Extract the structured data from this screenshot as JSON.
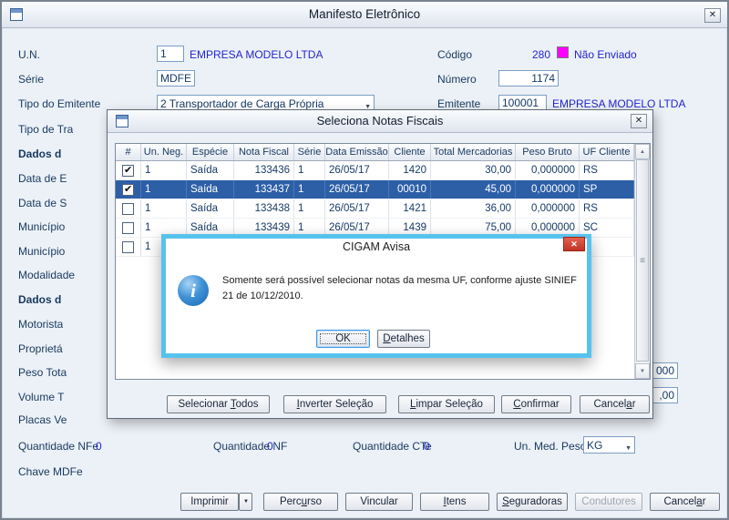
{
  "colors": {
    "status_swatch": "#FF00FF",
    "selected_row": "#2D5FA7",
    "avisa_border": "#57C3ED",
    "value_blue": "#2424CE"
  },
  "main_window": {
    "title": "Manifesto Eletrônico",
    "fields": {
      "un_label": "U.N.",
      "un_value": "1",
      "un_company": "EMPRESA MODELO LTDA",
      "codigo_label": "Código",
      "codigo_value": "280",
      "status_text": "Não Enviado",
      "serie_label": "Série",
      "serie_value": "MDFE",
      "numero_label": "Número",
      "numero_value": "1174",
      "tipo_emitente_label": "Tipo do Emitente",
      "tipo_emitente_value": "2 Transportador de Carga Própria",
      "emitente_label": "Emitente",
      "emitente_value": "100001",
      "emitente_company": "EMPRESA MODELO LTDA"
    },
    "left_labels": [
      "Tipo de Tra",
      "Dados d",
      "Data de E",
      "Data de S",
      "Município",
      "Município",
      "Modalidade",
      "Dados d",
      "Motorista",
      "Proprietá",
      "Peso Tota",
      "Volume T",
      "Placas Ve"
    ],
    "partial_fields": {
      "peso_tail": "000",
      "volume_tail": ",00"
    },
    "totals": {
      "qtde_nfe_label": "Quantidade NFe",
      "qtde_nfe_value": "0",
      "qtde_nf_label": "Quantidade NF",
      "qtde_nf_value": "0",
      "qtde_cte_label": "Quantidade CTe",
      "qtde_cte_value": "0",
      "un_med_peso_label": "Un. Med. Peso",
      "un_med_peso_value": "KG"
    },
    "chave_label": "Chave MDFe",
    "buttons": {
      "imprimir": "Imprimir",
      "percurso": "Perc&urso",
      "vincular": "Vincular",
      "itens": "&Itens",
      "seguradoras": "&Seguradoras",
      "condutores": "Condutores",
      "cancelar": "Cancel&ar"
    }
  },
  "notas_window": {
    "title": "Seleciona Notas Fiscais",
    "table": {
      "headers": [
        "#",
        "Un. Neg.",
        "Espécie",
        "Nota Fiscal",
        "Série",
        "Data Emissão",
        "Cliente",
        "Total Mercadorias",
        "Peso Bruto",
        "UF Cliente"
      ],
      "rows": [
        {
          "checked": true,
          "selected": false,
          "cells": [
            "1",
            "Saída",
            "133436",
            "1",
            "26/05/17",
            "1420",
            "30,00",
            "0,000000",
            "RS"
          ]
        },
        {
          "checked": true,
          "selected": true,
          "cells": [
            "1",
            "Saída",
            "133437",
            "1",
            "26/05/17",
            "00010",
            "45,00",
            "0,000000",
            "SP"
          ]
        },
        {
          "checked": false,
          "selected": false,
          "cells": [
            "1",
            "Saída",
            "133438",
            "1",
            "26/05/17",
            "1421",
            "36,00",
            "0,000000",
            "RS"
          ]
        },
        {
          "checked": false,
          "selected": false,
          "cells": [
            "1",
            "Saída",
            "133439",
            "1",
            "26/05/17",
            "1439",
            "75,00",
            "0,000000",
            "SC"
          ]
        },
        {
          "checked": false,
          "selected": false,
          "cells": [
            "1",
            "",
            "",
            "",
            "",
            "",
            "",
            "",
            ""
          ]
        }
      ]
    },
    "buttons": {
      "selecionar_todos": "Selecionar &Todos",
      "inverter": "&Inverter Seleção",
      "limpar": "&Limpar Seleção",
      "confirmar": "&Confirmar",
      "cancelar": "Cancel&ar"
    }
  },
  "avisa_dialog": {
    "title": "CIGAM Avisa",
    "message": "Somente será possível selecionar notas da mesma UF, conforme ajuste SINIEF 21 de 10/12/2010.",
    "buttons": {
      "ok": "OK",
      "detalhes": "&Detalhes"
    }
  }
}
